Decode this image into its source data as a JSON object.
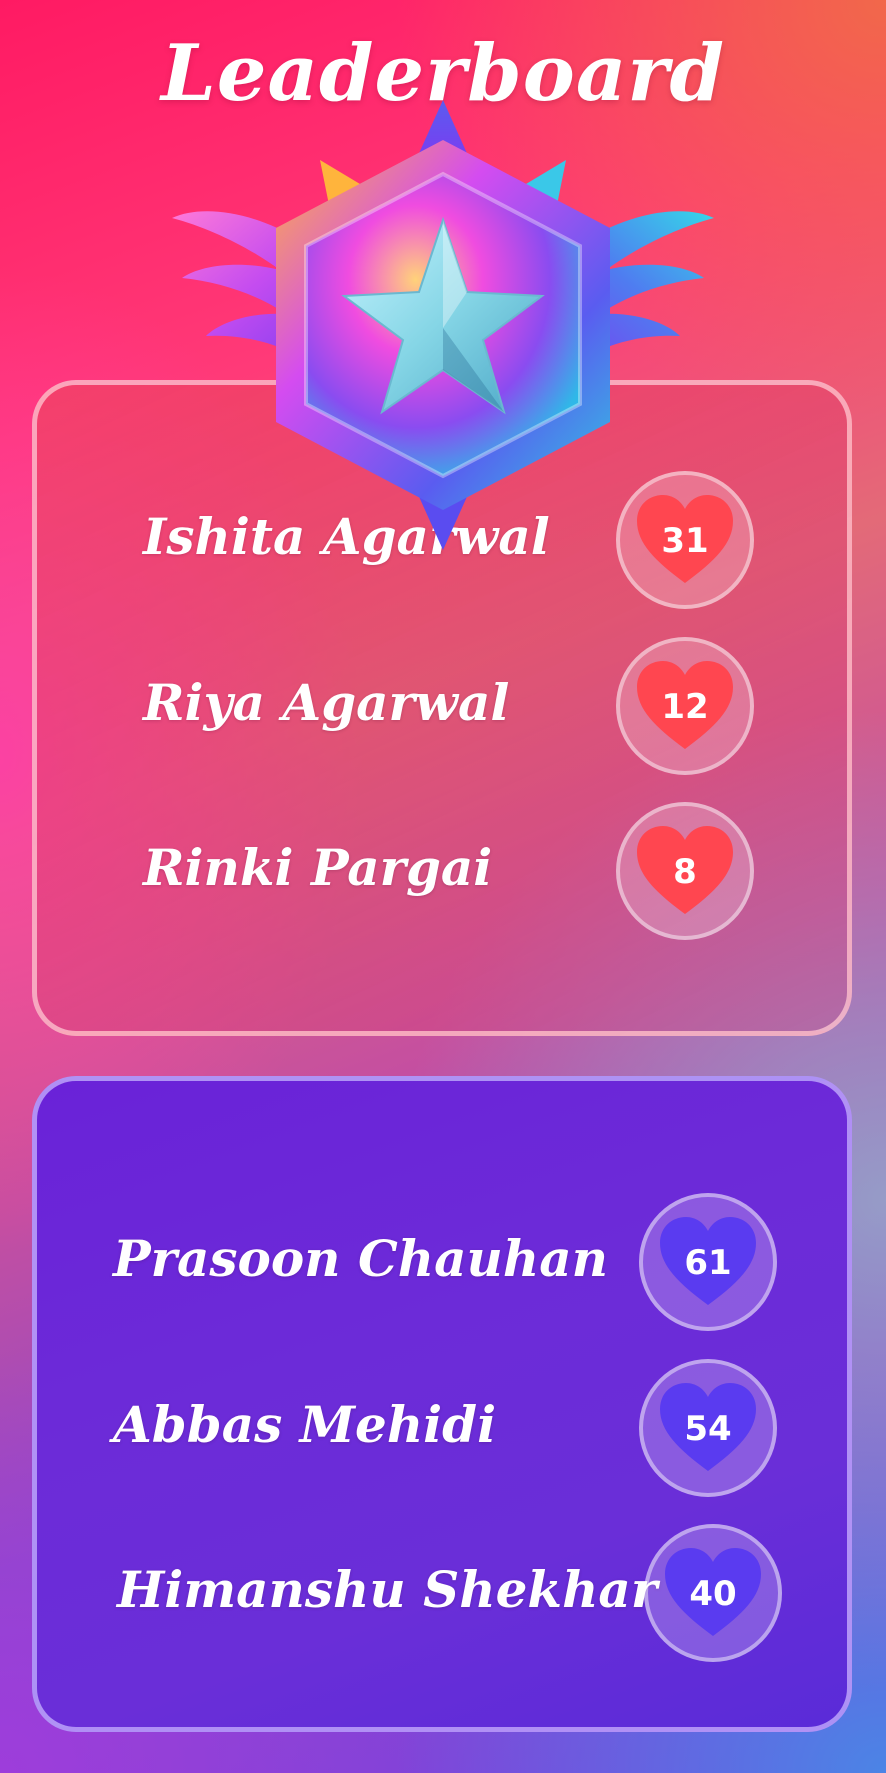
{
  "title": "Leaderboard",
  "colors": {
    "top_heart": "#ff4650",
    "bottom_heart": "#5a3bf0"
  },
  "top_group": [
    {
      "name": "Ishita Agarwal",
      "score": "31"
    },
    {
      "name": "Riya Agarwal",
      "score": "12"
    },
    {
      "name": "Rinki Pargai",
      "score": "8"
    }
  ],
  "bottom_group": [
    {
      "name": "Prasoon Chauhan",
      "score": "61"
    },
    {
      "name": "Abbas Mehidi",
      "score": "54"
    },
    {
      "name": "Himanshu Shekhar",
      "score": "40"
    }
  ],
  "medal_icon": "winged-star-medal-icon",
  "heart_icon": "heart-icon"
}
